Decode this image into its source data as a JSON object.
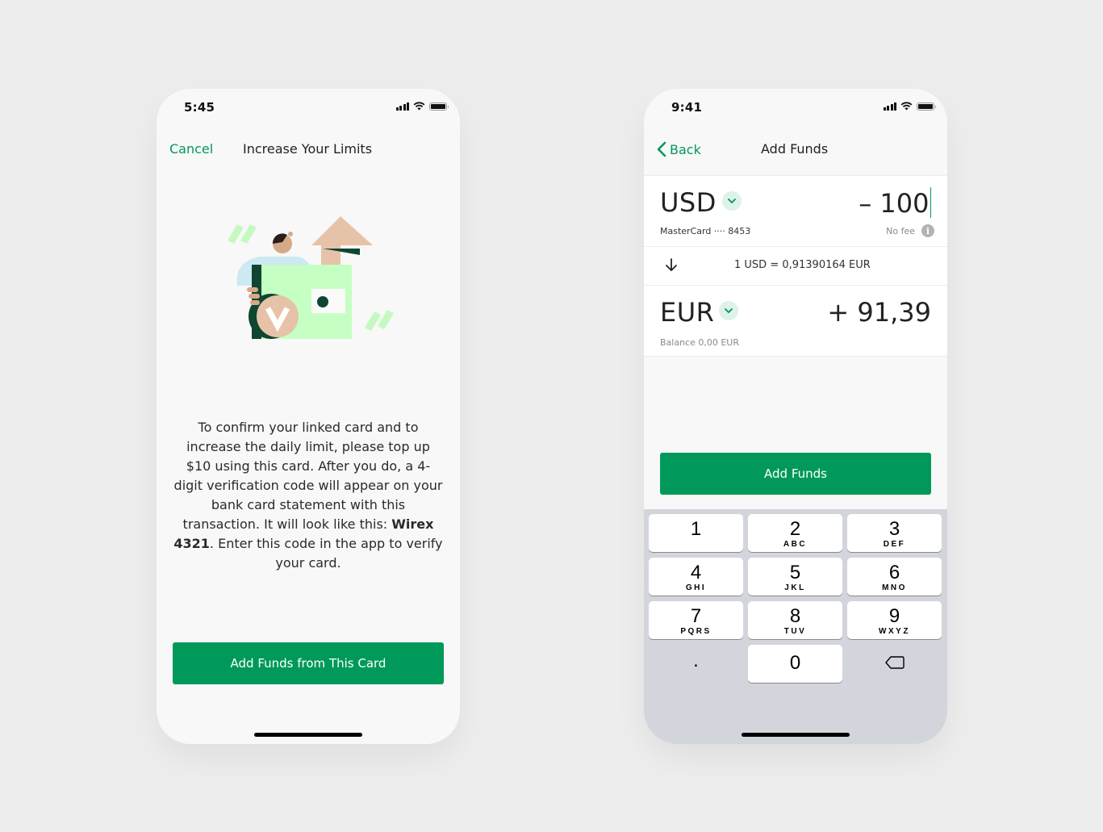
{
  "left_screen": {
    "status": {
      "time": "5:45"
    },
    "nav": {
      "cancel_label": "Cancel",
      "title": "Increase Your Limits"
    },
    "illustration": {
      "icon": "verified-card-illustration"
    },
    "info": {
      "text_before": "To confirm your linked card and to increase the daily limit, please top up $10 using this card. After you do, a 4-digit verification code will appear on your bank card statement with this transaction. It will look like this: ",
      "code_example": "Wirex 4321",
      "text_after": ". Enter this code in the app to verify your card."
    },
    "primary_button": "Add Funds from This Card"
  },
  "right_screen": {
    "status": {
      "time": "9:41"
    },
    "nav": {
      "back_label": "Back",
      "title": "Add Funds"
    },
    "from": {
      "currency": "USD",
      "amount": "– 100",
      "source": "MasterCard ···· 8453",
      "fee": "No fee"
    },
    "rate": {
      "text": "1 USD = 0,91390164 EUR"
    },
    "to": {
      "currency": "EUR",
      "amount": "+ 91,39",
      "balance": "Balance 0,00 EUR"
    },
    "primary_button": "Add Funds",
    "keypad": {
      "keys": [
        {
          "num": "1",
          "letters": ""
        },
        {
          "num": "2",
          "letters": "ABC"
        },
        {
          "num": "3",
          "letters": "DEF"
        },
        {
          "num": "4",
          "letters": "GHI"
        },
        {
          "num": "5",
          "letters": "JKL"
        },
        {
          "num": "6",
          "letters": "MNO"
        },
        {
          "num": "7",
          "letters": "PQRS"
        },
        {
          "num": "8",
          "letters": "TUV"
        },
        {
          "num": "9",
          "letters": "WXYZ"
        }
      ],
      "decimal": ".",
      "zero": "0"
    }
  },
  "colors": {
    "accent": "#00995a",
    "accent_light": "#dff2e8",
    "keypad_bg": "#d2d5db",
    "page_bg": "#ededed"
  }
}
